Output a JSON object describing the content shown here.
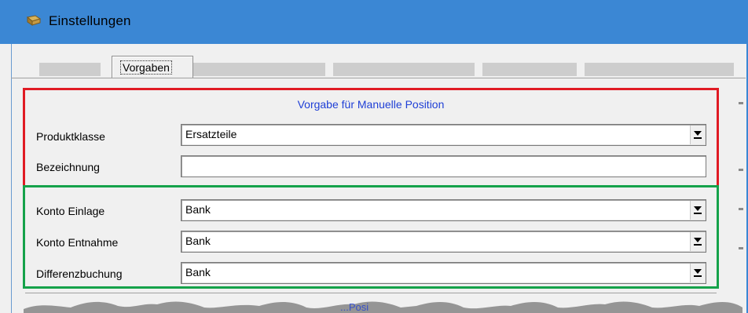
{
  "window": {
    "title": "Einstellungen"
  },
  "tabs": {
    "active_label": "Vorgaben"
  },
  "manual_position": {
    "section_title": "Vorgabe für Manuelle Position",
    "produktklasse_label": "Produktklasse",
    "produktklasse_value": "Ersatzteile",
    "bezeichnung_label": "Bezeichnung",
    "bezeichnung_value": ""
  },
  "accounts": {
    "konto_einlage_label": "Konto Einlage",
    "konto_einlage_value": "Bank",
    "konto_entnahme_label": "Konto Entnahme",
    "konto_entnahme_value": "Bank",
    "differenzbuchung_label": "Differenzbuchung",
    "differenzbuchung_value": "Bank"
  },
  "bottom": {
    "partial_link_text": "...Posi"
  },
  "colors": {
    "highlight_red": "#e01b24",
    "highlight_green": "#15a24a",
    "section_title": "#1f3fd6",
    "titlebar": "#3b87d4"
  },
  "icons": {
    "window_icon": "settings-app-icon",
    "combo_arrow": "chevron-down-icon"
  }
}
